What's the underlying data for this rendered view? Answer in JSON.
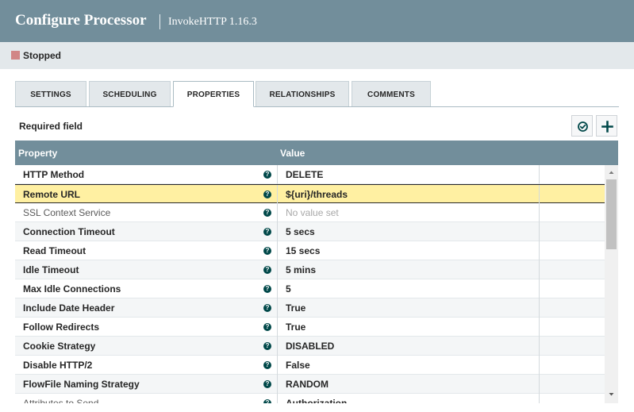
{
  "header": {
    "title": "Configure Processor",
    "subtitle": "InvokeHTTP 1.16.3"
  },
  "status": {
    "text": "Stopped",
    "color": "#d18686"
  },
  "tabs": [
    {
      "label": "SETTINGS",
      "active": false
    },
    {
      "label": "SCHEDULING",
      "active": false
    },
    {
      "label": "PROPERTIES",
      "active": true
    },
    {
      "label": "RELATIONSHIPS",
      "active": false
    },
    {
      "label": "COMMENTS",
      "active": false
    }
  ],
  "required_label": "Required field",
  "table": {
    "columns": [
      "Property",
      "Value"
    ],
    "rows": [
      {
        "property": "HTTP Method",
        "value": "DELETE",
        "required": true
      },
      {
        "property": "Remote URL",
        "value": "${uri}/threads",
        "required": true,
        "selected": true
      },
      {
        "property": "SSL Context Service",
        "value": "No value set",
        "required": false,
        "empty": true
      },
      {
        "property": "Connection Timeout",
        "value": "5 secs",
        "required": true
      },
      {
        "property": "Read Timeout",
        "value": "15 secs",
        "required": true
      },
      {
        "property": "Idle Timeout",
        "value": "5 mins",
        "required": true
      },
      {
        "property": "Max Idle Connections",
        "value": "5",
        "required": true
      },
      {
        "property": "Include Date Header",
        "value": "True",
        "required": true
      },
      {
        "property": "Follow Redirects",
        "value": "True",
        "required": true
      },
      {
        "property": "Cookie Strategy",
        "value": "DISABLED",
        "required": true
      },
      {
        "property": "Disable HTTP/2",
        "value": "False",
        "required": true
      },
      {
        "property": "FlowFile Naming Strategy",
        "value": "RANDOM",
        "required": true
      },
      {
        "property": "Attributes to Send",
        "value": "Authorization",
        "required": false
      }
    ]
  },
  "help_icon_glyph": "?",
  "colors": {
    "header": "#728e9b",
    "selected_row": "#fff0a2",
    "help_icon": "#004849"
  }
}
